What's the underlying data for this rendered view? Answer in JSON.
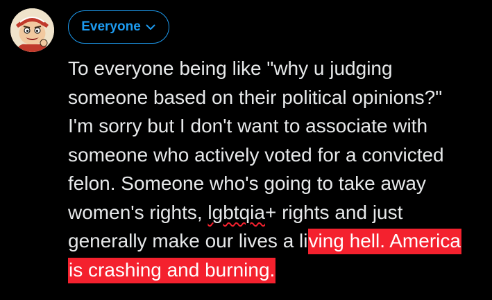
{
  "composer": {
    "audience_label": "Everyone",
    "text_lines": [
      "To everyone being like \"why u judging",
      "someone based on their political opinions?\"",
      "I'm sorry but I don't want to associate with",
      "someone who actively voted for a convicted",
      "felon. Someone who's going to take away"
    ],
    "line6_before": "women's rights, ",
    "line6_misspelled": "lgbtqia",
    "line6_after": "+ rights and just",
    "line7_normal": "generally make our lives a li",
    "line7_overflow": "ving hell. America",
    "line8_overflow": "is crashing and burning."
  },
  "colors": {
    "background": "#000000",
    "text": "#e7e9ea",
    "accent": "#1d9bf0",
    "overflow_highlight": "#f4212e"
  },
  "icons": {
    "avatar": "cartoon-avatar",
    "audience_chevron": "chevron-down-icon"
  }
}
